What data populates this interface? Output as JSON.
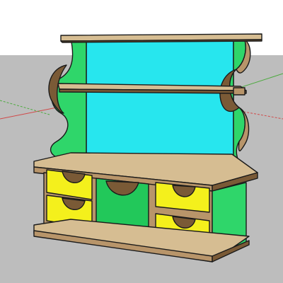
{
  "viewport": {
    "sky_color": "#ffffff",
    "ground_color": "#bdbdbd"
  },
  "axes": {
    "red_axis_color": "#d04a4a",
    "green_axis_color": "#4caa3e",
    "blue_axis_color": "#5a5ad0"
  },
  "model": {
    "wood_color": "#b8956a",
    "wood_dark_color": "#7a5a36",
    "wood_top_color": "#d6bd92",
    "outline_color": "#1a1a1a",
    "back_panel_color": "#27e6ee",
    "side_panel_color": "#2fd66a",
    "drawer_color": "#f4f01c",
    "center_panel_color": "#22c85a"
  }
}
